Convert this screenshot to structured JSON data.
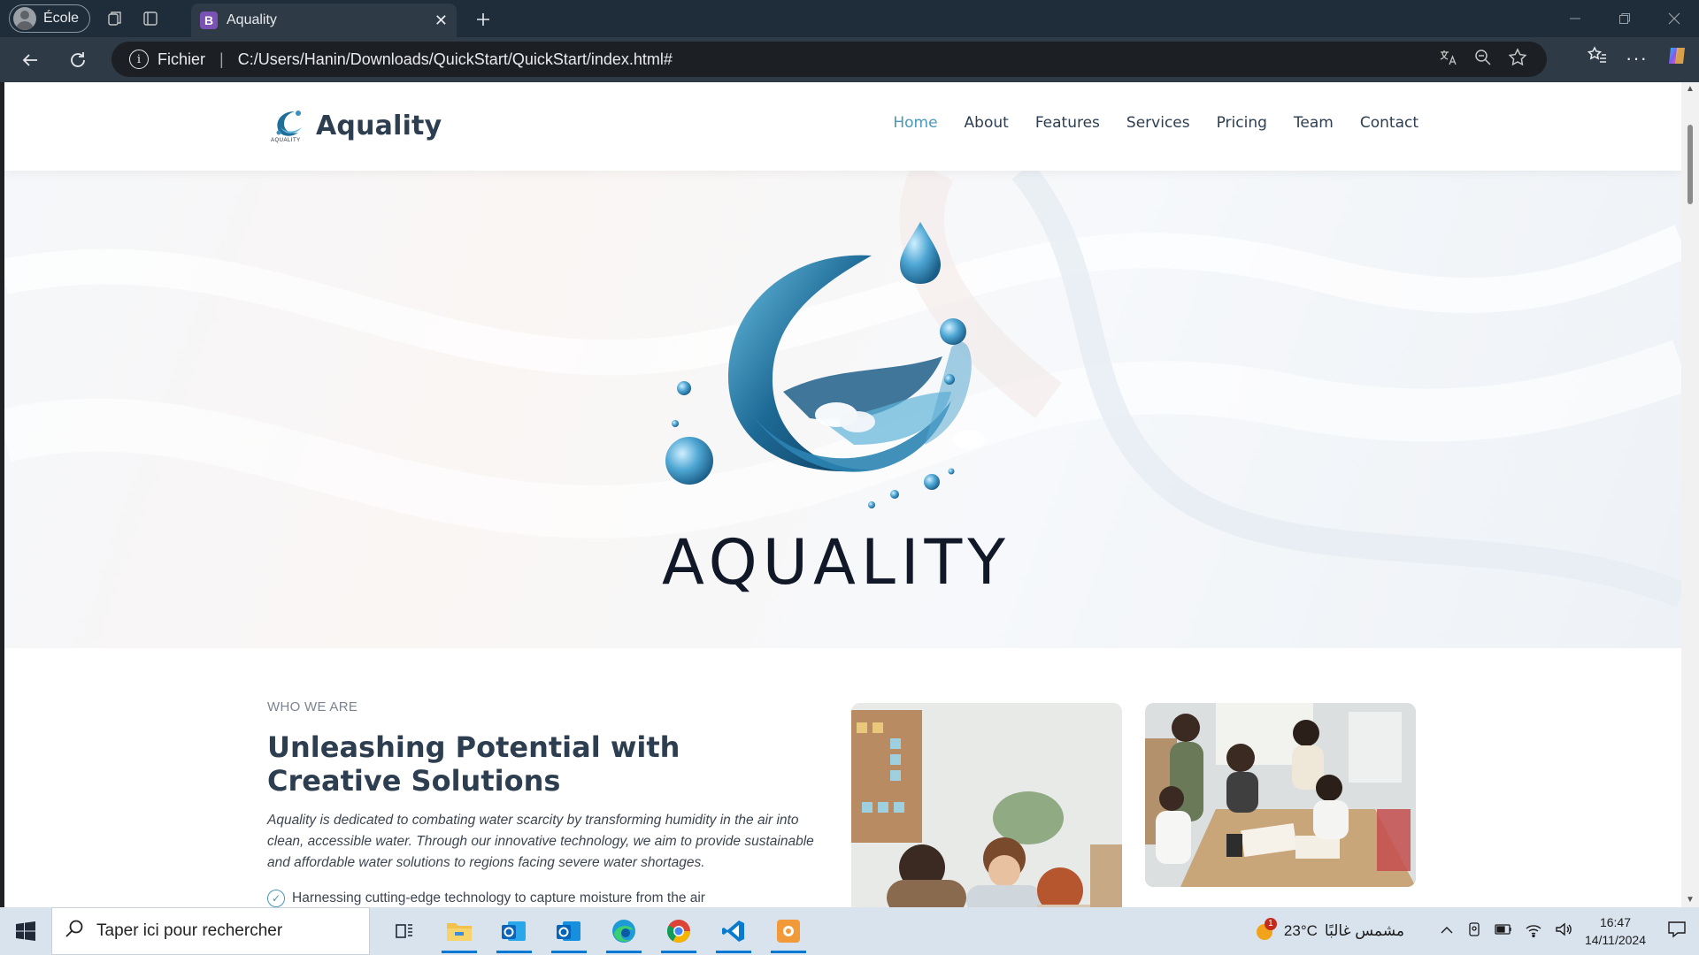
{
  "browser": {
    "profile_label": "École",
    "tab_title": "Aquality",
    "tab_favicon_letter": "B",
    "address": {
      "scheme_label": "Fichier",
      "separator": "|",
      "url": "C:/Users/Hanin/Downloads/QuickStart/QuickStart/index.html#"
    }
  },
  "site": {
    "brand_name": "Aquality",
    "brand_mini_caption": "AQUALITY",
    "nav": [
      {
        "label": "Home",
        "active": true
      },
      {
        "label": "About"
      },
      {
        "label": "Features"
      },
      {
        "label": "Services"
      },
      {
        "label": "Pricing"
      },
      {
        "label": "Team"
      },
      {
        "label": "Contact"
      }
    ],
    "hero_title": "AQUALITY",
    "who": {
      "eyebrow": "WHO WE ARE",
      "heading": "Unleashing Potential with Creative Solutions",
      "paragraph": "Aquality is dedicated to combating water scarcity by transforming humidity in the air into clean, accessible water. Through our innovative technology, we aim to provide sustainable and affordable water solutions to regions facing severe water shortages.",
      "check_item": "Harnessing cutting-edge technology to capture moisture from the air"
    }
  },
  "taskbar": {
    "search_placeholder": "Taper ici pour rechercher",
    "weather_temp": "23°C",
    "weather_text": "مشمس غالبًا",
    "weather_badge": "1",
    "time": "16:47",
    "date": "14/11/2024"
  },
  "colors": {
    "accent": "#4a98b8",
    "heading": "#2d3e50",
    "totop": "#2a8bb0"
  }
}
